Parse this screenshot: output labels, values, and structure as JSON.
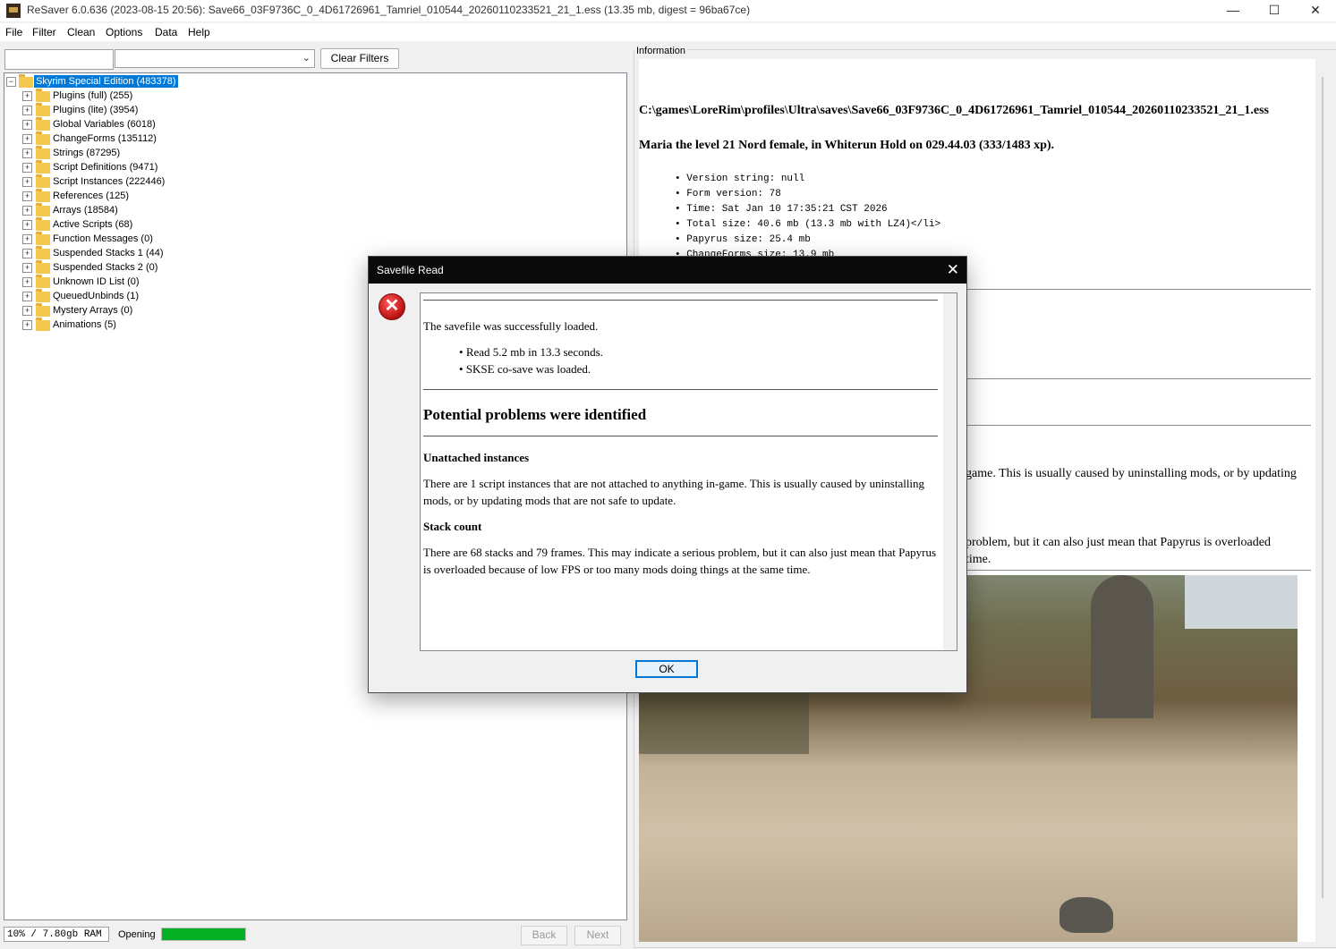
{
  "window": {
    "title": "ReSaver 6.0.636 (2023-08-15 20:56): Save66_03F9736C_0_4D61726961_Tamriel_010544_20260110233521_21_1.ess (13.35 mb, digest = 96ba67ce)",
    "minimize": "—",
    "maximize": "☐",
    "close": "✕"
  },
  "menu": [
    "File",
    "Filter",
    "Clean",
    "Options",
    "Data",
    "Help"
  ],
  "filter": {
    "text_value": "",
    "select_value": "",
    "clear_label": "Clear Filters"
  },
  "tree": {
    "root": {
      "label": "Skyrim Special Edition (483378)",
      "expander": "−"
    },
    "items": [
      {
        "label": "Plugins (full) (255)",
        "expander": "+"
      },
      {
        "label": "Plugins (lite) (3954)",
        "expander": "+"
      },
      {
        "label": "Global Variables (6018)",
        "expander": "+"
      },
      {
        "label": "ChangeForms (135112)",
        "expander": "+"
      },
      {
        "label": "Strings (87295)",
        "expander": "+"
      },
      {
        "label": "Script Definitions (9471)",
        "expander": "+"
      },
      {
        "label": "Script Instances (222446)",
        "expander": "+"
      },
      {
        "label": "References (125)",
        "expander": "+"
      },
      {
        "label": "Arrays (18584)",
        "expander": "+"
      },
      {
        "label": "Active Scripts (68)",
        "expander": "+"
      },
      {
        "label": "Function Messages (0)",
        "expander": "+"
      },
      {
        "label": "Suspended Stacks 1 (44)",
        "expander": "+"
      },
      {
        "label": "Suspended Stacks 2 (0)",
        "expander": "+"
      },
      {
        "label": "Unknown ID List (0)",
        "expander": "+"
      },
      {
        "label": "QueuedUnbinds (1)",
        "expander": "+"
      },
      {
        "label": "Mystery Arrays (0)",
        "expander": "+"
      },
      {
        "label": "Animations (5)",
        "expander": "+"
      }
    ]
  },
  "status": {
    "ram": "10% / 7.80gb RAM",
    "opening": "Opening",
    "progress": 1.0,
    "back": "Back",
    "next": "Next"
  },
  "info": {
    "legend": "Information",
    "path": "C:\\games\\LoreRim\\profiles\\Ultra\\saves\\Save66_03F9736C_0_4D61726961_Tamriel_010544_20260110233521_21_1.ess",
    "summary": "Maria the level 21 Nord female, in Whiterun Hold on 029.44.03 (333/1483 xp).",
    "bullets": [
      "Version string: null",
      "Form version: 78",
      "Time: Sat Jan 10 17:35:21 CST 2026",
      "Total size: 40.6 mb (13.3 mb with LZ4)</li>",
      "Papyrus size: 25.4 mb",
      "ChangeForms size: 13.9 mb"
    ],
    "partial_1a": "game. This is usually caused by uninstalling mods, or by updating",
    "partial_2a": "problem, but it can also just mean that Papyrus is overloaded",
    "partial_2b": "time."
  },
  "dialog": {
    "title": "Savefile Read",
    "close": "✕",
    "icon": "error-icon",
    "loaded": "The savefile was successfully loaded.",
    "bullets": [
      "Read 5.2 mb in 13.3 seconds.",
      "SKSE co-save was loaded."
    ],
    "heading": "Potential problems were identified",
    "sub1": "Unattached instances",
    "para1": "There are 1 script instances that are not attached to anything in-game. This is usually caused by uninstalling mods, or by updating mods that are not safe to update.",
    "sub2": "Stack count",
    "para2": "There are 68 stacks and 79 frames. This may indicate a serious problem, but it can also just mean that Papyrus is overloaded because of low FPS or too many mods doing things at the same time.",
    "ok": "OK"
  },
  "colors": {
    "selection": "#0078d7",
    "progress": "#06b025",
    "dialog_title_bg": "#0a0a0a",
    "error": "#c01515"
  }
}
